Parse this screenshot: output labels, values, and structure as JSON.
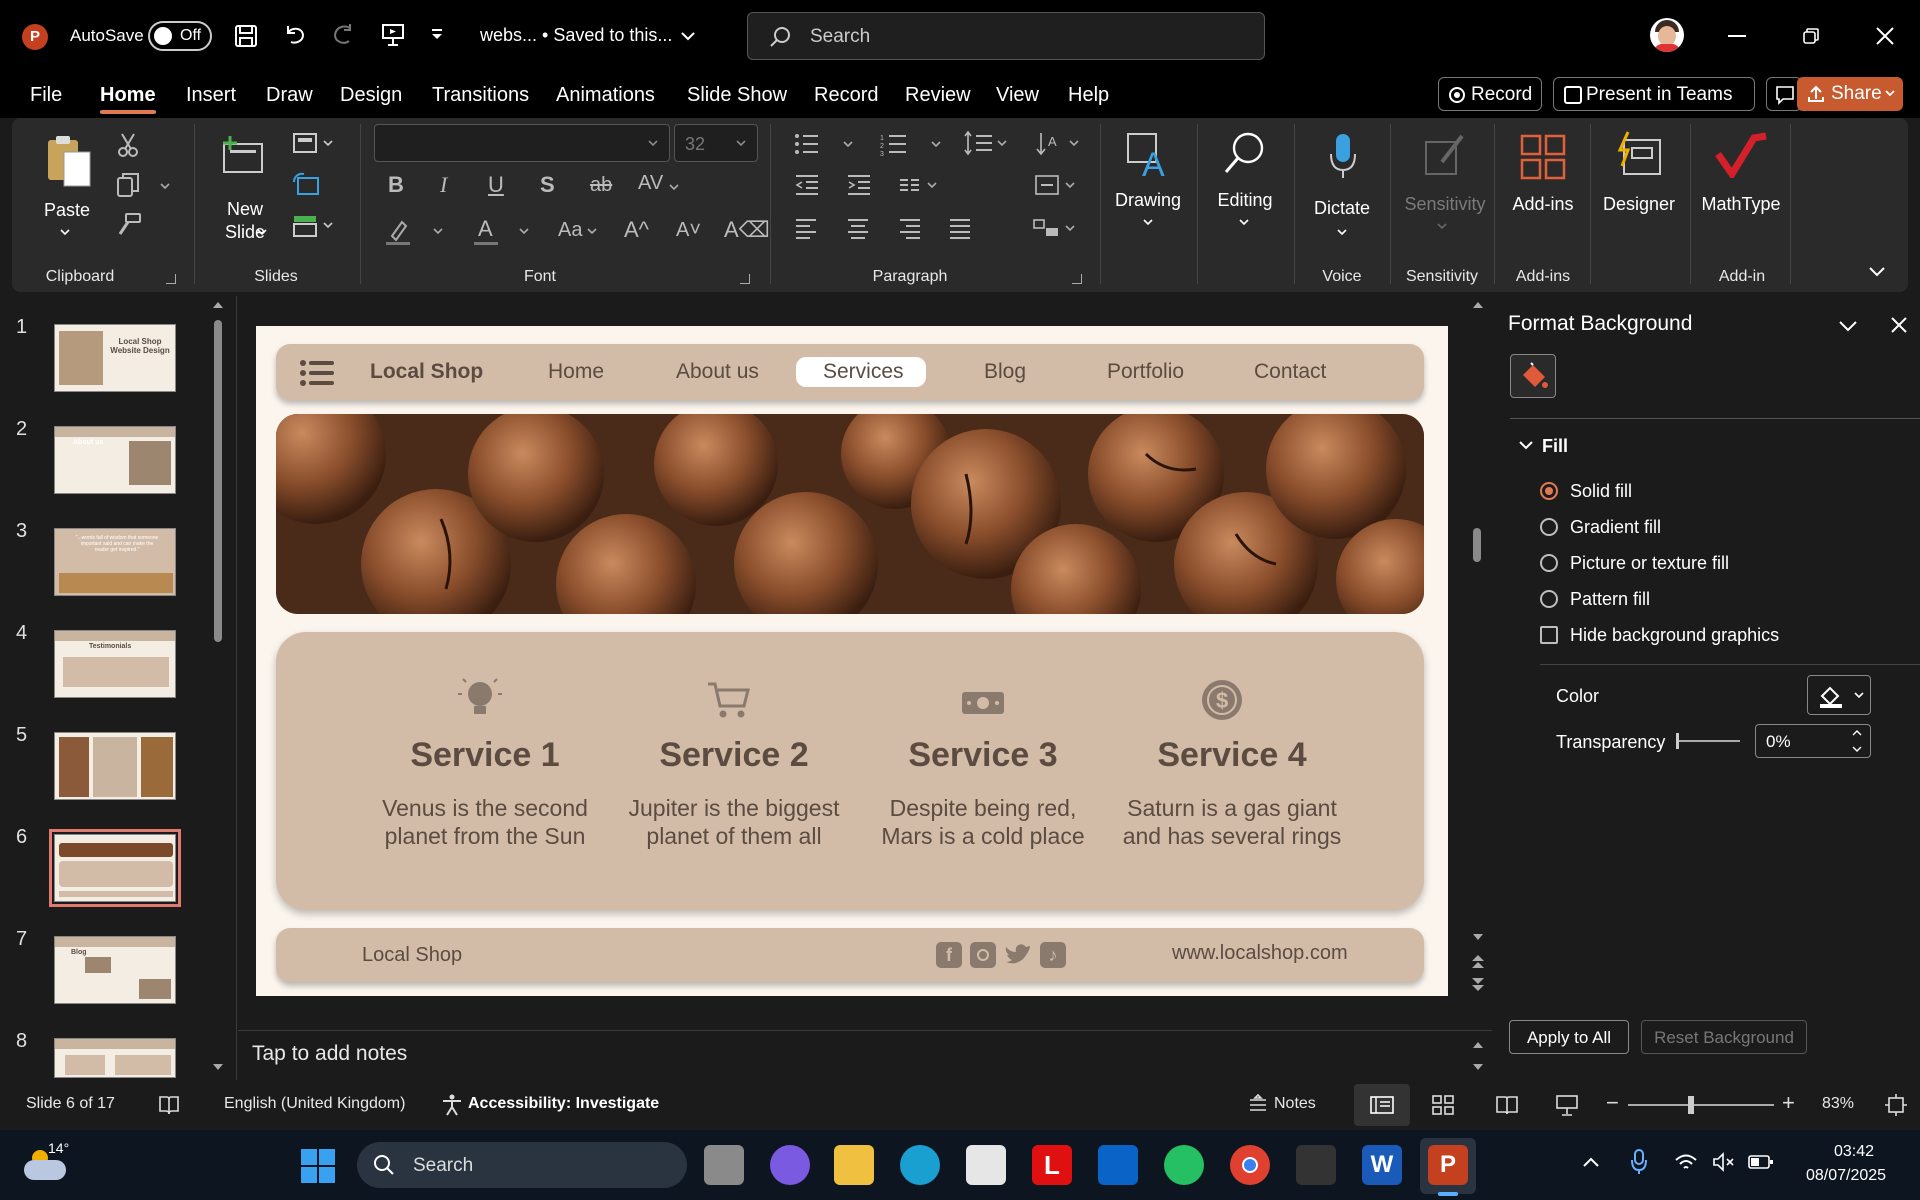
{
  "titlebar": {
    "autosave_label": "AutoSave",
    "autosave_state": "Off",
    "doc_title": "webs... • Saved to this...",
    "search_placeholder": "Search"
  },
  "menu": [
    "File",
    "Home",
    "Insert",
    "Draw",
    "Design",
    "Transitions",
    "Animations",
    "Slide Show",
    "Record",
    "Review",
    "View",
    "Help"
  ],
  "menu_active": "Home",
  "menu_actions": {
    "record": "Record",
    "present": "Present in Teams",
    "share": "Share"
  },
  "ribbon": {
    "paste": "Paste",
    "new_slide": "New Slide",
    "font_size": "32",
    "drawing": "Drawing",
    "editing": "Editing",
    "dictate": "Dictate",
    "sensitivity": "Sensitivity",
    "addins": "Add-ins",
    "designer": "Designer",
    "mathtype": "MathType",
    "groups": {
      "clipboard": "Clipboard",
      "slides": "Slides",
      "font": "Font",
      "paragraph": "Paragraph",
      "voice": "Voice",
      "sensitivity": "Sensitivity",
      "addins": "Add-ins",
      "addin": "Add-in"
    }
  },
  "thumbnails": [
    {
      "num": "1",
      "text": "Local Shop Website Design"
    },
    {
      "num": "2",
      "text": "About us"
    },
    {
      "num": "3",
      "text": "\"...words full of wisdom that someone important said and can make the reader get inspired.\""
    },
    {
      "num": "4",
      "text": "Testimonials"
    },
    {
      "num": "5",
      "text": ""
    },
    {
      "num": "6",
      "text": ""
    },
    {
      "num": "7",
      "text": "Blog"
    },
    {
      "num": "8",
      "text": ""
    }
  ],
  "selected_thumbnail": "6",
  "slide": {
    "brand": "Local Shop",
    "nav": [
      "Home",
      "About us",
      "Services",
      "Blog",
      "Portfolio",
      "Contact"
    ],
    "nav_active": "Services",
    "services": [
      {
        "title": "Service 1",
        "line1": "Venus is the second",
        "line2": "planet from the Sun",
        "icon": "lightbulb-icon"
      },
      {
        "title": "Service 2",
        "line1": "Jupiter is the biggest",
        "line2": "planet of them all",
        "icon": "cart-icon"
      },
      {
        "title": "Service 3",
        "line1": "Despite being red,",
        "line2": "Mars is a cold place",
        "icon": "money-icon"
      },
      {
        "title": "Service 4",
        "line1": "Saturn is a gas giant",
        "line2": "and has several rings",
        "icon": "dollar-coin-icon"
      }
    ],
    "footer_brand": "Local Shop",
    "footer_url": "www.localshop.com"
  },
  "notes_placeholder": "Tap to add notes",
  "pane": {
    "title": "Format Background",
    "section": "Fill",
    "options": [
      "Solid fill",
      "Gradient fill",
      "Picture or texture fill",
      "Pattern fill"
    ],
    "selected": "Solid fill",
    "hide_graphics": "Hide background graphics",
    "color_label": "Color",
    "transparency_label": "Transparency",
    "transparency_value": "0%",
    "apply_all": "Apply to All",
    "reset": "Reset Background"
  },
  "status": {
    "slide": "Slide 6 of 17",
    "language": "English (United Kingdom)",
    "accessibility": "Accessibility: Investigate",
    "notes": "Notes",
    "zoom": "83%"
  },
  "taskbar": {
    "weather": "14°",
    "search": "Search",
    "time": "03:42",
    "date": "08/07/2025"
  },
  "colors": {
    "accent": "#e07a55",
    "slide_tan": "#d3bca7",
    "slide_text": "#5b4b41",
    "share_bg": "#c75a2f"
  }
}
